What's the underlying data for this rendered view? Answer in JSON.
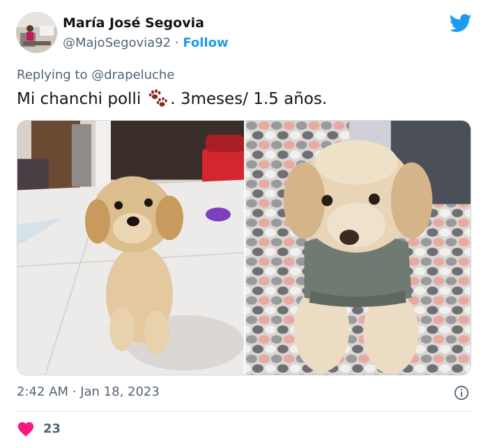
{
  "user": {
    "name": "María José Segovia",
    "handle": "@MajoSegovia92",
    "separator": "·",
    "follow_label": "Follow"
  },
  "reply": {
    "prefix": "Replying to",
    "mention": "@drapeluche"
  },
  "tweet": {
    "text_before": "Mi chanchi polli",
    "text_after": ". 3meses/ 1.5 años.",
    "emoji_icon": "paw-prints-icon"
  },
  "media": {
    "left_image": "puppy-photo",
    "right_image": "dog-in-sweater-photo"
  },
  "meta": {
    "time": "2:42 AM",
    "separator": "·",
    "date": "Jan 18, 2023"
  },
  "stats": {
    "likes": "23"
  },
  "colors": {
    "accent": "#1d9bf0",
    "heart": "#f91880",
    "secondary_text": "#536471"
  }
}
